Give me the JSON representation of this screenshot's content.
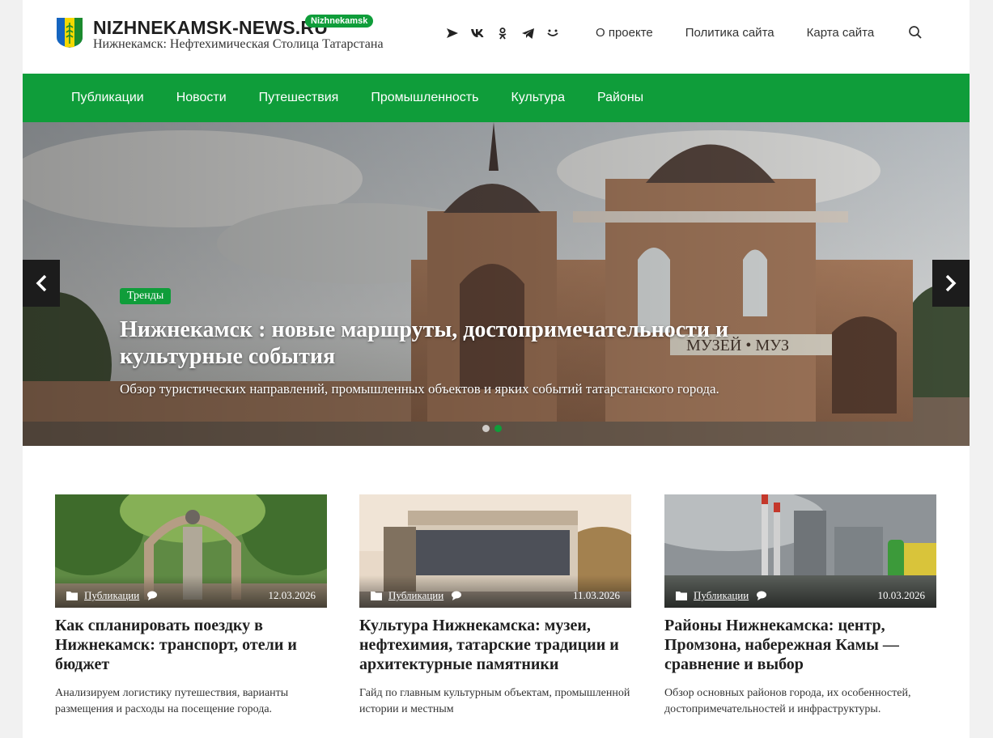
{
  "header": {
    "site_name": "NIZHNEKAMSK-NEWS.RU",
    "site_badge": "Nizhnekamsk",
    "tagline": "Нижнекамск: Нефтехимическая Столица Татарстана",
    "socials": [
      "paper-plane-icon",
      "vk-icon",
      "odnoklassniki-icon",
      "telegram-icon",
      "smile-icon"
    ],
    "nav": [
      "О проекте",
      "Политика сайта",
      "Карта сайта"
    ]
  },
  "mainnav": {
    "items": [
      "Публикации",
      "Новости",
      "Путешествия",
      "Промышленность",
      "Культура",
      "Районы"
    ]
  },
  "hero": {
    "tag": "Тренды",
    "title": "Нижнекамск : новые маршруты, достопримечательности и культурные события",
    "subtitle": "Обзор туристических направлений, промышленных объектов и ярких событий татарстанского города.",
    "slides_total": 2,
    "slide_active": 2
  },
  "cards": [
    {
      "category": "Публикации",
      "date": "12.03.2026",
      "title": "Как спланировать поездку в Нижнекамск: транспорт, отели и бюджет",
      "excerpt": "Анализируем логистику путешествия, варианты размещения и расходы на посещение города."
    },
    {
      "category": "Публикации",
      "date": "11.03.2026",
      "title": "Культура Нижнекамска: музеи, нефтехимия, татарские традиции и архитектурные памятники",
      "excerpt": "Гайд по главным культурным объектам, промышленной истории и местным"
    },
    {
      "category": "Публикации",
      "date": "10.03.2026",
      "title": "Районы Нижнекамска: центр, Промзона, набережная Камы — сравнение и выбор",
      "excerpt": "Обзор основных районов города, их особенностей, достопримечательностей и инфраструктуры."
    }
  ],
  "colors": {
    "brand_green": "#0f9d3a",
    "page_bg": "#f1f1f1"
  }
}
